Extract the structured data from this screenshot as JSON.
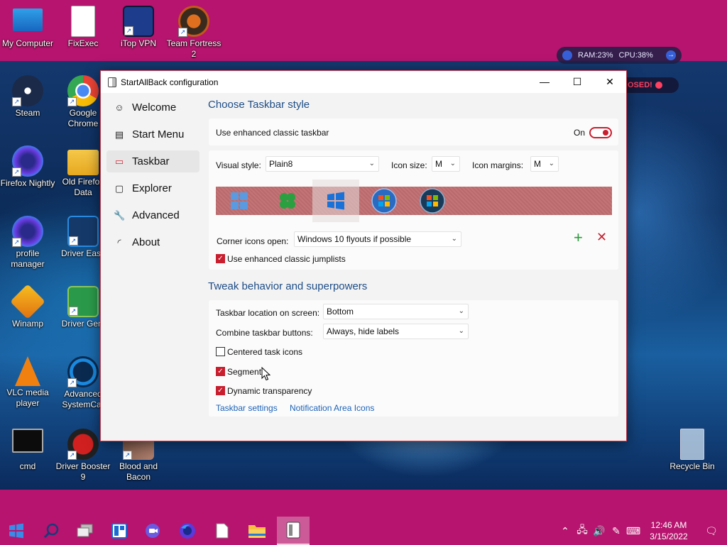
{
  "desktop": {
    "icons": [
      {
        "id": "my-computer",
        "label": "My Computer"
      },
      {
        "id": "fixexec",
        "label": "FixExec"
      },
      {
        "id": "itop-vpn",
        "label": "iTop VPN"
      },
      {
        "id": "team-fortress",
        "label": "Team Fortress 2"
      },
      {
        "id": "steam",
        "label": "Steam"
      },
      {
        "id": "google-chrome",
        "label": "Google Chrome"
      },
      {
        "id": "firefox-nightly",
        "label": "Firefox Nightly"
      },
      {
        "id": "old-firefox-data",
        "label": "Old Firefox Data"
      },
      {
        "id": "profile-manager",
        "label": "profile manager"
      },
      {
        "id": "driver-easy",
        "label": "Driver Easy"
      },
      {
        "id": "winamp",
        "label": "Winamp"
      },
      {
        "id": "driver-genius",
        "label": "Driver Geni"
      },
      {
        "id": "vlc",
        "label": "VLC media player"
      },
      {
        "id": "advanced-systemcare",
        "label": "Advanced SystemCar"
      },
      {
        "id": "cmd",
        "label": "cmd"
      },
      {
        "id": "driver-booster",
        "label": "Driver Booster 9"
      },
      {
        "id": "blood-and-bacon",
        "label": "Blood and Bacon"
      },
      {
        "id": "recycle-bin",
        "label": "Recycle Bin"
      }
    ]
  },
  "hud": {
    "ram": "RAM:23%",
    "cpu": "CPU:38%"
  },
  "closed_chip": "OSED!",
  "window": {
    "title": "StartAllBack configuration",
    "nav": [
      {
        "label": "Welcome",
        "icon": "smile-icon",
        "glyph": "☺"
      },
      {
        "label": "Start Menu",
        "icon": "start-menu-icon",
        "glyph": "▤"
      },
      {
        "label": "Taskbar",
        "icon": "taskbar-icon",
        "glyph": "▭"
      },
      {
        "label": "Explorer",
        "icon": "explorer-icon",
        "glyph": "▢"
      },
      {
        "label": "Advanced",
        "icon": "wrench-icon",
        "glyph": "🔧"
      },
      {
        "label": "About",
        "icon": "gauge-icon",
        "glyph": "◜"
      }
    ],
    "active_nav": "Taskbar",
    "section1_title": "Choose Taskbar style",
    "enhanced_label": "Use enhanced classic taskbar",
    "toggle_state": "On",
    "visual_style_label": "Visual style:",
    "visual_style_value": "Plain8",
    "icon_size_label": "Icon size:",
    "icon_size_value": "M",
    "icon_margins_label": "Icon margins:",
    "icon_margins_value": "M",
    "style_options": [
      "Windows 10 tiles",
      "Windows 8 clover",
      "Windows 10 logo",
      "Windows 7 orb",
      "Windows Vista orb"
    ],
    "selected_style_index": 2,
    "corner_label": "Corner icons open:",
    "corner_value": "Windows 10 flyouts if possible",
    "jumplists_label": "Use enhanced classic jumplists",
    "section2_title": "Tweak behavior and superpowers",
    "location_label": "Taskbar location on screen:",
    "location_value": "Bottom",
    "combine_label": "Combine taskbar buttons:",
    "combine_value": "Always, hide labels",
    "centered_label": "Centered task icons",
    "segments_label": "Segments",
    "dynamic_label": "Dynamic transparency",
    "taskbar_settings_link": "Taskbar settings",
    "notification_link": "Notification Area Icons",
    "checks": {
      "jumplists": true,
      "centered": false,
      "segments": true,
      "dynamic": true
    }
  },
  "taskbar": {
    "buttons": [
      "start-icon",
      "search-icon",
      "task-view-icon",
      "widgets-icon",
      "chat-icon",
      "firefox-icon",
      "file-icon",
      "file-explorer-icon",
      "startallback-icon"
    ],
    "active_index": 8
  },
  "clock": {
    "time": "12:46 AM",
    "date": "3/15/2022"
  },
  "colors": {
    "accent": "#c81e2e",
    "taskbar": "#b6146e",
    "link": "#1d63b8",
    "heading": "#1e4d86"
  }
}
